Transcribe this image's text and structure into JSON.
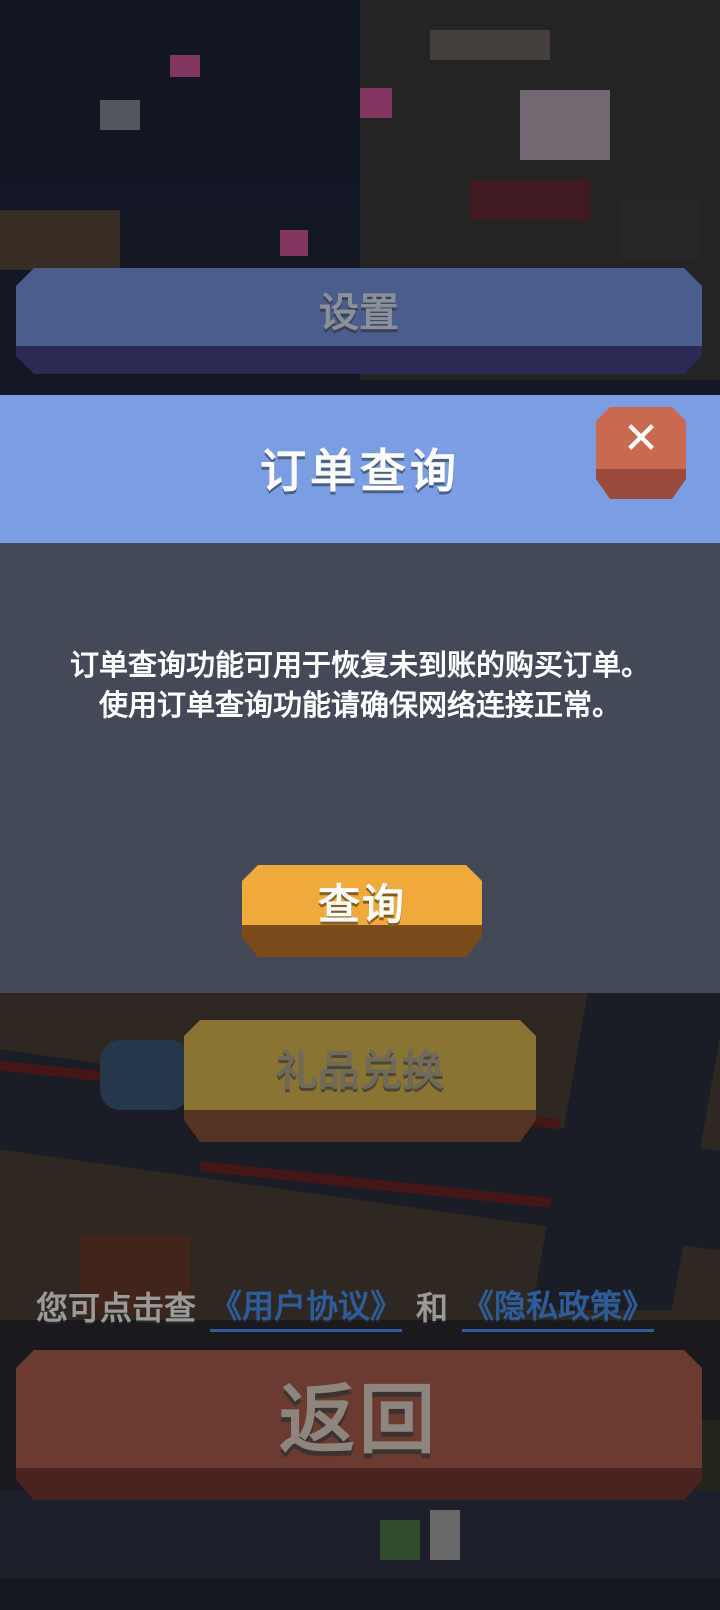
{
  "background_menu": {
    "settings_label": "设置",
    "gift_exchange_label": "礼品兑换",
    "back_label": "返回"
  },
  "agreement": {
    "prefix": "您可点击查",
    "user_agreement": "《用户协议》",
    "conjunction": "和",
    "privacy_policy": "《隐私政策》"
  },
  "dialog": {
    "title": "订单查询",
    "close_icon": "close-icon",
    "message_lines": [
      "订单查询功能可用于恢复未到账的购买订单。",
      "使用订单查询功能请确保网络连接正常。"
    ],
    "query_button": "查询"
  },
  "colors": {
    "header": "#7a9de3",
    "body": "#434957",
    "close_button": "#c9694f",
    "query_button": "#f0a93b"
  }
}
